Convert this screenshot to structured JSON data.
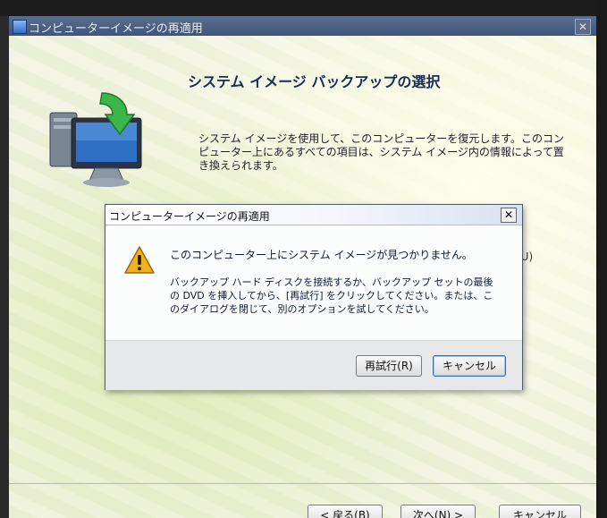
{
  "main_window": {
    "title": "コンピューターイメージの再適用",
    "close_glyph": "✕",
    "heading": "システム イメージ バックアップの選択",
    "description": "システム イメージを使用して、このコンピューターを復元します。このコンピューター上にあるすべての項目は、システム イメージ内の情報によって置き換えられます。",
    "obscured_text": "(U)",
    "buttons": {
      "back": "< 戻る(B)",
      "next": "次へ(N) >",
      "cancel": "キャンセル"
    }
  },
  "dialog": {
    "title": "コンピューターイメージの再適用",
    "close_glyph": "✕",
    "message": "このコンピューター上にシステム イメージが見つかりません。",
    "detail": "バックアップ ハード ディスクを接続するか、バックアップ セットの最後の DVD を挿入してから、[再試行] をクリックしてください。または、このダイアログを閉じて、別のオプションを試してください。",
    "buttons": {
      "retry": "再試行(R)",
      "cancel": "キャンセル"
    },
    "icon": "warning-icon"
  },
  "colors": {
    "heading": "#1b2b55",
    "titlebar": "#40567a",
    "warning": "#f0b020"
  }
}
